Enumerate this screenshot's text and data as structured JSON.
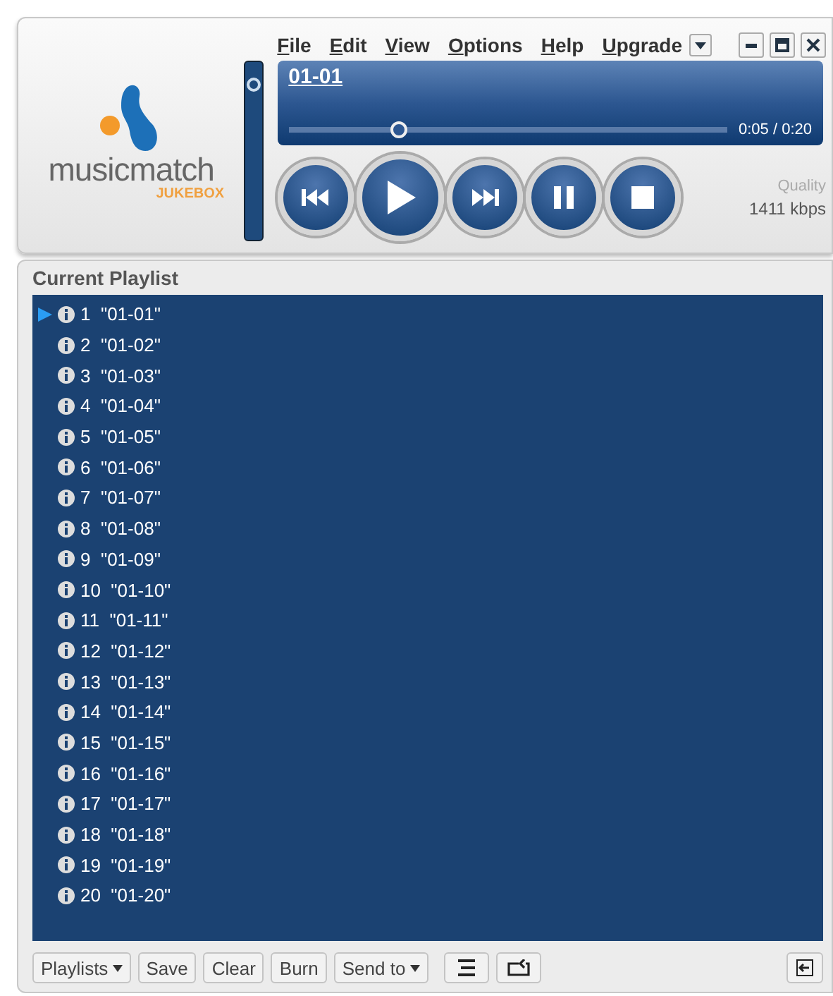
{
  "menu": [
    "File",
    "Edit",
    "View",
    "Options",
    "Help",
    "Upgrade"
  ],
  "logo": {
    "name": "musicmatch",
    "sub": "JUKEBOX"
  },
  "volume": {
    "level": 0.9
  },
  "now_playing": {
    "title": "01-01",
    "time": "0:05 / 0:20",
    "level": 0.25
  },
  "quality": {
    "label": "Quality",
    "value": "1411 kbps"
  },
  "controls": [
    {
      "kind": "prev"
    },
    {
      "kind": "play"
    },
    {
      "kind": "next"
    },
    {
      "kind": "pause"
    },
    {
      "kind": "stop"
    }
  ],
  "playlist": {
    "title": "Current Playlist",
    "tracks": [
      {
        "text": "1  \"01-01\"",
        "playing": true
      },
      {
        "text": "2  \"01-02\"",
        "playing": false
      },
      {
        "text": "3  \"01-03\"",
        "playing": false
      },
      {
        "text": "4  \"01-04\"",
        "playing": false
      },
      {
        "text": "5  \"01-05\"",
        "playing": false
      },
      {
        "text": "6  \"01-06\"",
        "playing": false
      },
      {
        "text": "7  \"01-07\"",
        "playing": false
      },
      {
        "text": "8  \"01-08\"",
        "playing": false
      },
      {
        "text": "9  \"01-09\"",
        "playing": false
      },
      {
        "text": "10  \"01-10\"",
        "playing": false
      },
      {
        "text": "11  \"01-11\"",
        "playing": false
      },
      {
        "text": "12  \"01-12\"",
        "playing": false
      },
      {
        "text": "13  \"01-13\"",
        "playing": false
      },
      {
        "text": "14  \"01-14\"",
        "playing": false
      },
      {
        "text": "15  \"01-15\"",
        "playing": false
      },
      {
        "text": "16  \"01-16\"",
        "playing": false
      },
      {
        "text": "17  \"01-17\"",
        "playing": false
      },
      {
        "text": "18  \"01-18\"",
        "playing": false
      },
      {
        "text": "19  \"01-19\"",
        "playing": false
      },
      {
        "text": "20  \"01-20\"",
        "playing": false
      }
    ]
  },
  "bottom_buttons": [
    {
      "label": "Playlists",
      "dropdown": true
    },
    {
      "label": "Save",
      "dropdown": false
    },
    {
      "label": "Clear",
      "dropdown": false
    },
    {
      "label": "Burn",
      "dropdown": false
    },
    {
      "label": "Send to",
      "dropdown": true
    }
  ]
}
